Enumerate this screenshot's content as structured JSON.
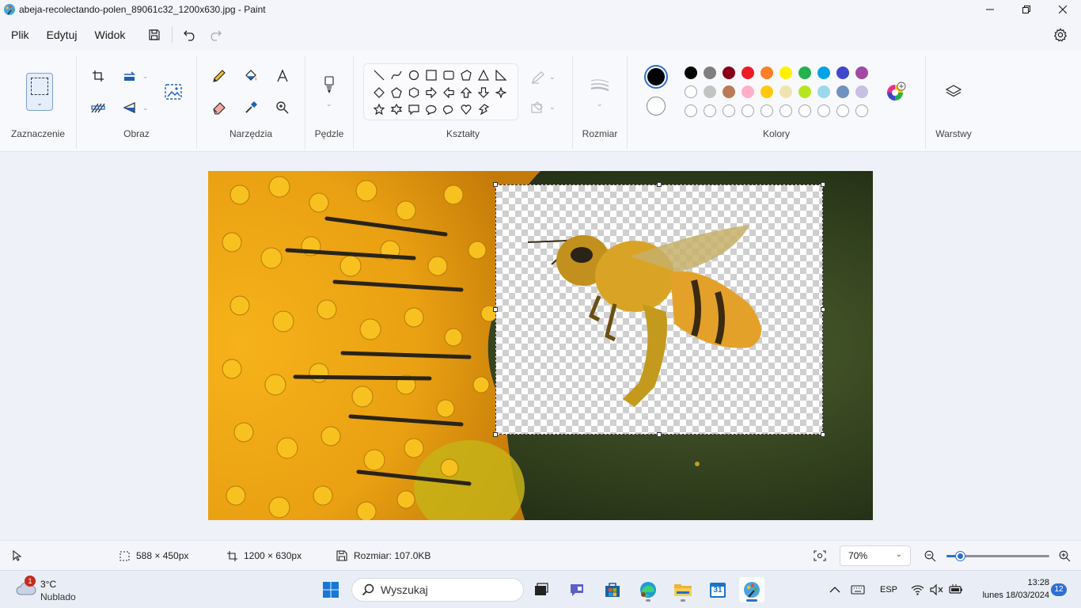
{
  "window": {
    "title": "abeja-recolectando-polen_89061c32_1200x630.jpg - Paint"
  },
  "menu": {
    "items": [
      "Plik",
      "Edytuj",
      "Widok"
    ]
  },
  "ribbon": {
    "groups": {
      "selection": "Zaznaczenie",
      "image": "Obraz",
      "tools": "Narzędzia",
      "brushes": "Pędzle",
      "shapes": "Kształty",
      "size": "Rozmiar",
      "colors": "Kolory",
      "layers": "Warstwy"
    },
    "palette_row1": [
      "#000000",
      "#7f7f7f",
      "#880015",
      "#ed1c24",
      "#ff7f27",
      "#fff200",
      "#22b14c",
      "#00a2e8",
      "#3f48cc",
      "#a349a4"
    ],
    "palette_row2": [
      "#ffffff",
      "#c3c3c3",
      "#b97a57",
      "#ffaec9",
      "#ffc90e",
      "#efe4b0",
      "#b5e61d",
      "#99d9ea",
      "#7092be",
      "#c8bfe7"
    ],
    "primary_color": "#000000",
    "secondary_color": "#ffffff"
  },
  "status": {
    "selection_size": "588 × 450px",
    "canvas_size": "1200 × 630px",
    "file_size": "Rozmiar: 107.0KB",
    "zoom": "70%",
    "zoom_slider_percent": 14
  },
  "taskbar": {
    "weather_temp": "3°C",
    "weather_cond": "Nublado",
    "weather_badge": "1",
    "search_placeholder": "Wyszukaj",
    "language": "ESP",
    "time": "13:28",
    "date": "lunes 18/03/2024",
    "notifications": "12",
    "calendar_day": "31"
  }
}
